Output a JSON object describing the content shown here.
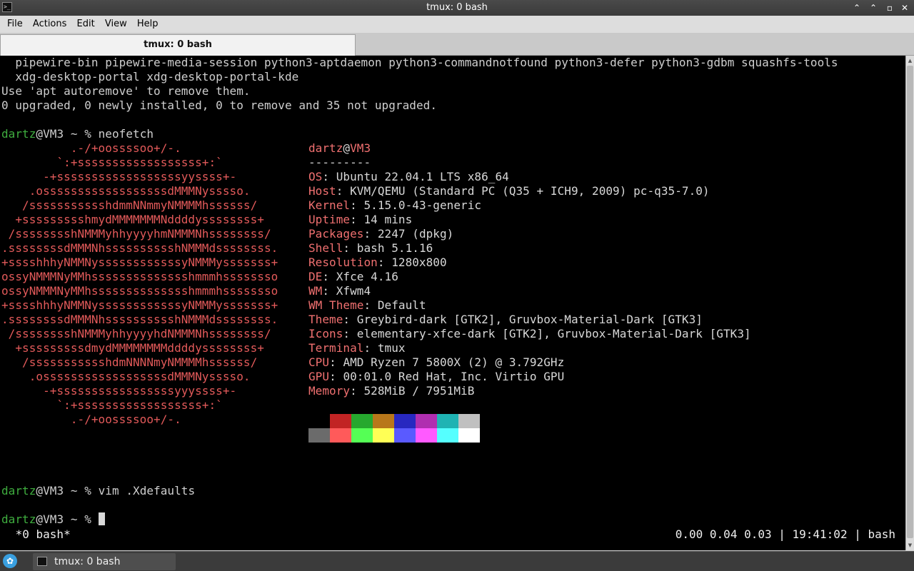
{
  "window": {
    "title": "tmux: 0 bash",
    "icon": "terminal-icon",
    "controls": {
      "minimize": "minimize-icon",
      "maximize": "maximize-icon",
      "close": "close-icon"
    }
  },
  "menu": [
    "File",
    "Actions",
    "Edit",
    "View",
    "Help"
  ],
  "tab": {
    "label": "tmux: 0 bash"
  },
  "terminal": {
    "pre_lines": [
      "  pipewire-bin pipewire-media-session python3-aptdaemon python3-commandnotfound python3-defer python3-gdbm squashfs-tools",
      "  xdg-desktop-portal xdg-desktop-portal-kde",
      "Use 'apt autoremove' to remove them.",
      "0 upgraded, 0 newly installed, 0 to remove and 35 not upgraded."
    ],
    "prompt": {
      "user": "dartz",
      "at": "@",
      "host": "VM3",
      "suffix": " ~ % "
    },
    "commands": [
      "neofetch",
      "vim .Xdefaults",
      ""
    ],
    "logo": [
      "          .-/+oossssoo+/-.",
      "        `:+ssssssssssssssssss+:`",
      "      -+ssssssssssssssssssyyssss+-",
      "    .ossssssssssssssssssdMMMNysssso.",
      "   /ssssssssssshdmmNNmmyNMMMMhssssss/",
      "  +ssssssssshmydMMMMMMMNddddyssssssss+",
      " /sssssssshNMMMyhhyyyyhmNMMMNhssssssss/",
      ".ssssssssdMMMNhsssssssssshNMMMdssssssss.",
      "+sssshhhyNMMNyssssssssssssyNMMMysssssss+",
      "ossyNMMMNyMMhsssssssssssssshmmmhssssssso",
      "ossyNMMMNyMMhsssssssssssssshmmmhssssssso",
      "+sssshhhyNMMNyssssssssssssyNMMMysssssss+",
      ".ssssssssdMMMNhsssssssssshNMMMdssssssss.",
      " /sssssssshNMMMyhhyyyyhdNMMMNhssssssss/",
      "  +sssssssssdmydMMMMMMMMddddyssssssss+",
      "   /ssssssssssshdmNNNNmyNMMMMhssssss/",
      "    .ossssssssssssssssssdMMMNysssso.",
      "      -+sssssssssssssssssyyyssss+-",
      "        `:+ssssssssssssssssss+:`",
      "          .-/+oossssoo+/-."
    ],
    "neofetch": {
      "user": "dartz",
      "at": "@",
      "host": "VM3",
      "separator": "---------",
      "fields": [
        {
          "label": "OS",
          "value": "Ubuntu 22.04.1 LTS x86_64"
        },
        {
          "label": "Host",
          "value": "KVM/QEMU (Standard PC (Q35 + ICH9, 2009) pc-q35-7.0)"
        },
        {
          "label": "Kernel",
          "value": "5.15.0-43-generic"
        },
        {
          "label": "Uptime",
          "value": "14 mins"
        },
        {
          "label": "Packages",
          "value": "2247 (dpkg)"
        },
        {
          "label": "Shell",
          "value": "bash 5.1.16"
        },
        {
          "label": "Resolution",
          "value": "1280x800"
        },
        {
          "label": "DE",
          "value": "Xfce 4.16"
        },
        {
          "label": "WM",
          "value": "Xfwm4"
        },
        {
          "label": "WM Theme",
          "value": "Default"
        },
        {
          "label": "Theme",
          "value": "Greybird-dark [GTK2], Gruvbox-Material-Dark [GTK3]"
        },
        {
          "label": "Icons",
          "value": "elementary-xfce-dark [GTK2], Gruvbox-Material-Dark [GTK3]"
        },
        {
          "label": "Terminal",
          "value": "tmux"
        },
        {
          "label": "CPU",
          "value": "AMD Ryzen 7 5800X (2) @ 3.792GHz"
        },
        {
          "label": "GPU",
          "value": "00:01.0 Red Hat, Inc. Virtio GPU"
        },
        {
          "label": "Memory",
          "value": "528MiB / 7951MiB"
        }
      ],
      "palette_row1": [
        "#000000",
        "#c22424",
        "#26a82e",
        "#b8771a",
        "#2828c0",
        "#b02eb0",
        "#1fb3b3",
        "#c0c0c0"
      ],
      "palette_row2": [
        "#6b6b6b",
        "#ff5a5a",
        "#55ff55",
        "#ffff55",
        "#5a5aff",
        "#ff5aff",
        "#55ffff",
        "#ffffff"
      ]
    },
    "status": {
      "left": " *0 bash*",
      "right": "0.00 0.04 0.03 | 19:41:02 | bash"
    },
    "colors": {
      "prompt_user": "#3fae3f",
      "logo": "#e35a5a",
      "label": "#f07070",
      "background": "#000000"
    }
  },
  "taskbar": {
    "launcher_icon": "whisker-menu-icon",
    "task": {
      "label": "tmux: 0 bash",
      "icon": "terminal-icon"
    }
  }
}
